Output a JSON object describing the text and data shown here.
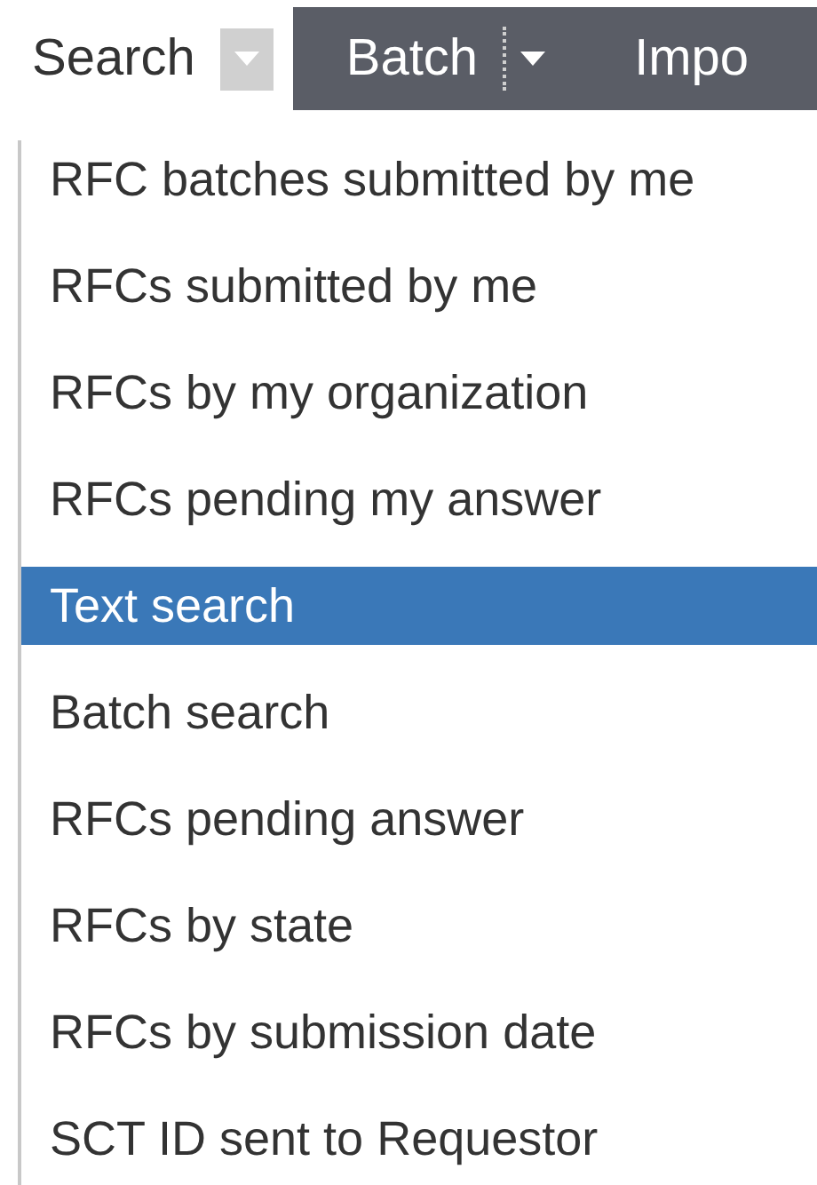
{
  "toolbar": {
    "search_label": "Search",
    "batch_label": "Batch",
    "import_label": "Impo"
  },
  "menu": {
    "items": [
      {
        "label": "RFC batches submitted by me",
        "selected": false
      },
      {
        "label": "RFCs submitted by me",
        "selected": false
      },
      {
        "label": "RFCs by my organization",
        "selected": false
      },
      {
        "label": "RFCs pending my answer",
        "selected": false
      },
      {
        "label": "Text search",
        "selected": true
      },
      {
        "label": "Batch search",
        "selected": false
      },
      {
        "label": "RFCs pending answer",
        "selected": false
      },
      {
        "label": "RFCs by state",
        "selected": false
      },
      {
        "label": "RFCs by submission date",
        "selected": false
      },
      {
        "label": "SCT ID sent to Requestor",
        "selected": false
      }
    ]
  }
}
